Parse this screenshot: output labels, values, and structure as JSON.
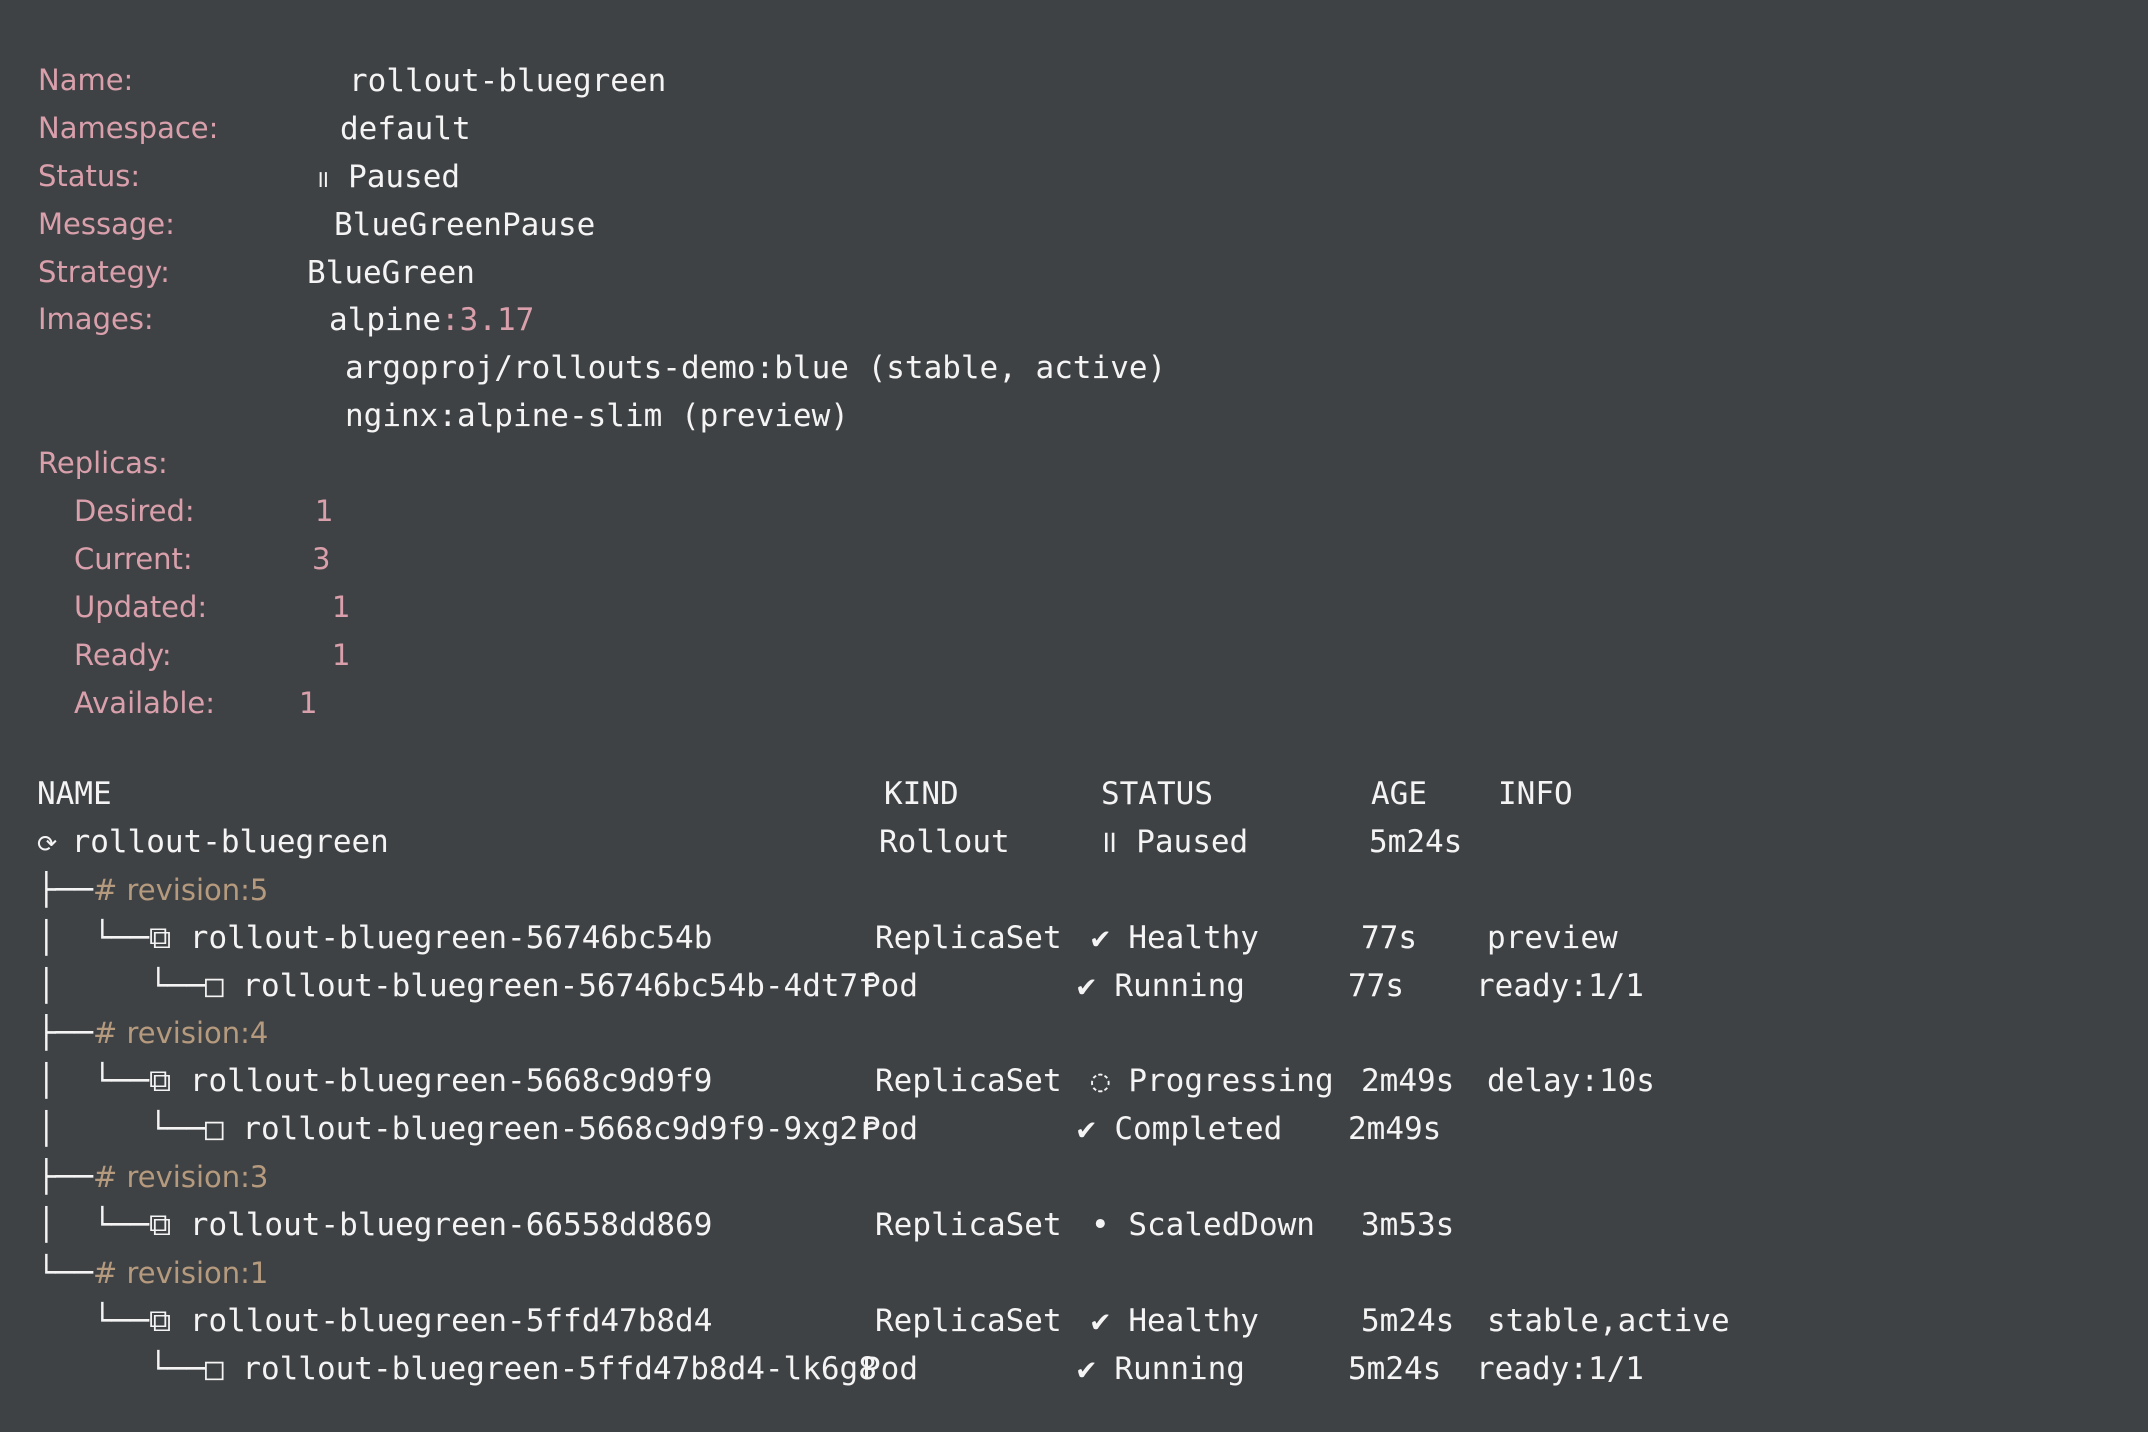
{
  "details": {
    "name_label": "Name:",
    "name_value": "rollout-bluegreen",
    "namespace_label": "Namespace:",
    "namespace_value": "default",
    "status_label": "Status:",
    "status_icon": "॥",
    "status_value": "Paused",
    "message_label": "Message:",
    "message_value": "BlueGreenPause",
    "strategy_label": "Strategy:",
    "strategy_value": "BlueGreen",
    "images_label": "Images:",
    "images": [
      {
        "name": "alpine",
        "tag": ":3.17"
      },
      {
        "text": "argoproj/rollouts-demo:blue (stable, active)"
      },
      {
        "text": "nginx:alpine-slim (preview)"
      }
    ],
    "replicas_label": "Replicas:",
    "replicas": {
      "desired_label": "Desired:",
      "desired": "1",
      "current_label": "Current:",
      "current": "3",
      "updated_label": "Updated:",
      "updated": "1",
      "ready_label": "Ready:",
      "ready": "1",
      "available_label": "Available:",
      "available": "1"
    }
  },
  "table": {
    "headers": {
      "name": "NAME",
      "kind": "KIND",
      "status": "STATUS",
      "age": "AGE",
      "info": "INFO"
    },
    "rows": [
      {
        "prefix": "⟳ ",
        "name": "rollout-bluegreen",
        "kind": "Rollout",
        "status": "॥ Paused",
        "age": "5m24s",
        "info": ""
      },
      {
        "prefix": "├──",
        "revision": "# revision:5"
      },
      {
        "prefix": "│  └──⧉ ",
        "name": "rollout-bluegreen-56746bc54b",
        "kind": "ReplicaSet",
        "status": "✔ Healthy",
        "age": "77s",
        "info": "preview"
      },
      {
        "prefix": "│     └──□ ",
        "name": "rollout-bluegreen-56746bc54b-4dt7f",
        "kind": "Pod",
        "status": "✔ Running",
        "age": "77s",
        "info": "ready:1/1"
      },
      {
        "prefix": "├──",
        "revision": "# revision:4"
      },
      {
        "prefix": "│  └──⧉ ",
        "name": "rollout-bluegreen-5668c9d9f9",
        "kind": "ReplicaSet",
        "status": "◌ Progressing",
        "age": "2m49s",
        "info": "delay:10s"
      },
      {
        "prefix": "│     └──□ ",
        "name": "rollout-bluegreen-5668c9d9f9-9xg2r",
        "kind": "Pod",
        "status": "✔ Completed",
        "age": "2m49s",
        "info": ""
      },
      {
        "prefix": "├──",
        "revision": "# revision:3"
      },
      {
        "prefix": "│  └──⧉ ",
        "name": "rollout-bluegreen-66558dd869",
        "kind": "ReplicaSet",
        "status": "• ScaledDown",
        "age": "3m53s",
        "info": ""
      },
      {
        "prefix": "└──",
        "revision": "# revision:1"
      },
      {
        "prefix": "   └──⧉ ",
        "name": "rollout-bluegreen-5ffd47b8d4",
        "kind": "ReplicaSet",
        "status": "✔ Healthy",
        "age": "5m24s",
        "info": "stable,active"
      },
      {
        "prefix": "      └──□ ",
        "name": "rollout-bluegreen-5ffd47b8d4-lk6g8",
        "kind": "Pod",
        "status": "✔ Running",
        "age": "5m24s",
        "info": "ready:1/1"
      }
    ]
  },
  "colors": {
    "background": "#3f4245",
    "label": "#d9a0ac",
    "revision": "#b59a7e",
    "text": "#f4f4f4"
  }
}
